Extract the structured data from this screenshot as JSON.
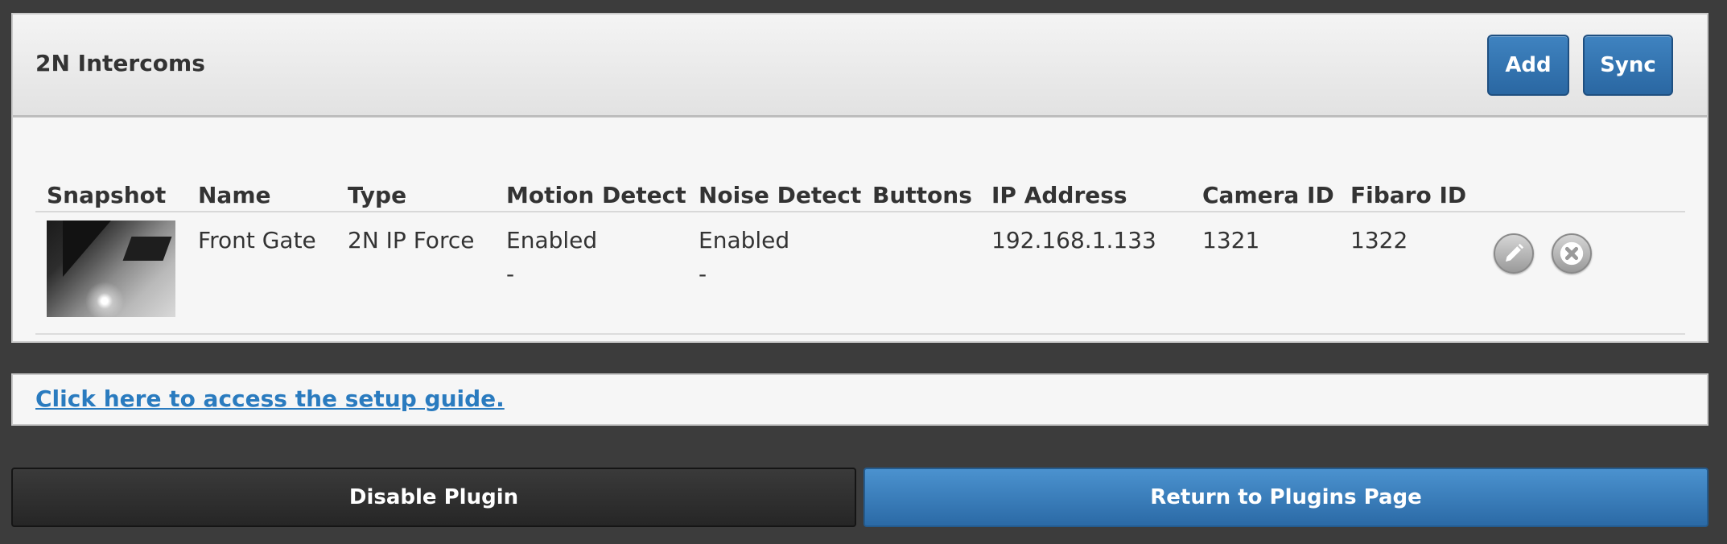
{
  "panel": {
    "title": "2N Intercoms",
    "add_label": "Add",
    "sync_label": "Sync"
  },
  "table": {
    "columns": [
      "Snapshot",
      "Name",
      "Type",
      "Motion Detect",
      "Noise Detect",
      "Buttons",
      "IP Address",
      "Camera ID",
      "Fibaro ID"
    ],
    "rows": [
      {
        "name": "Front Gate",
        "type": "2N IP Force",
        "motion_detect": "Enabled",
        "motion_detect_sub": "-",
        "noise_detect": "Enabled",
        "noise_detect_sub": "-",
        "buttons": "",
        "ip_address": "192.168.1.133",
        "camera_id": "1321",
        "fibaro_id": "1322"
      }
    ]
  },
  "guide": {
    "link_text": "Click here to access the setup guide."
  },
  "footer": {
    "disable_label": "Disable Plugin",
    "return_label": "Return to Plugins Page"
  },
  "icons": {
    "edit": "pencil-icon",
    "delete": "close-icon"
  },
  "colors": {
    "background": "#3c3c3c",
    "primary_button": "#2a67a2",
    "link": "#2a7bbf",
    "dark_button": "#2b2b2b"
  }
}
